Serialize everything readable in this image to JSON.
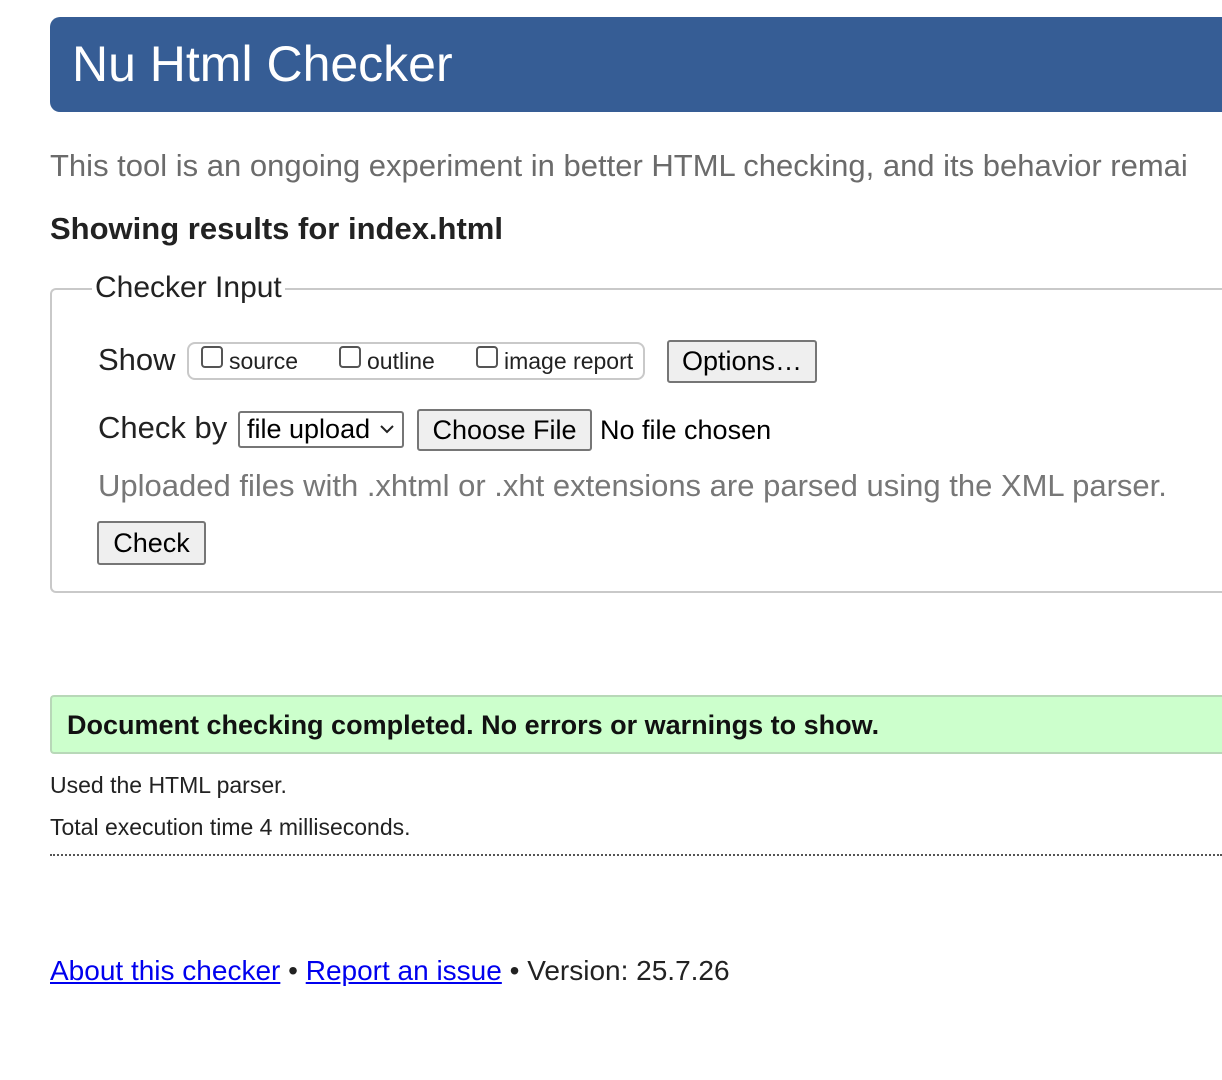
{
  "header": {
    "title": "Nu Html Checker"
  },
  "intro": {
    "text": "This tool is an ongoing experiment in better HTML checking, and its behavior remai"
  },
  "results_heading": "Showing results for index.html",
  "checker_input": {
    "legend": "Checker Input",
    "show_label": "Show",
    "show_options": [
      {
        "label": "source",
        "checked": false
      },
      {
        "label": "outline",
        "checked": false
      },
      {
        "label": "image report",
        "checked": false
      }
    ],
    "options_button": "Options…",
    "check_by_label": "Check by",
    "check_by_selected": "file upload",
    "choose_file_button": "Choose File",
    "no_file_text": "No file chosen",
    "upload_note": "Uploaded files with .xhtml or .xht extensions are parsed using the XML parser.",
    "check_button": "Check"
  },
  "result": {
    "success_message": "Document checking completed. No errors or warnings to show.",
    "parser_note": "Used the HTML parser.",
    "execution_time": "Total execution time 4 milliseconds."
  },
  "footer": {
    "about_link": "About this checker",
    "separator": "•",
    "report_link": "Report an issue",
    "version": "Version: 25.7.26"
  },
  "colors": {
    "header_bg": "#365d95",
    "success_bg": "#ccffcc",
    "link": "#0000ee"
  }
}
